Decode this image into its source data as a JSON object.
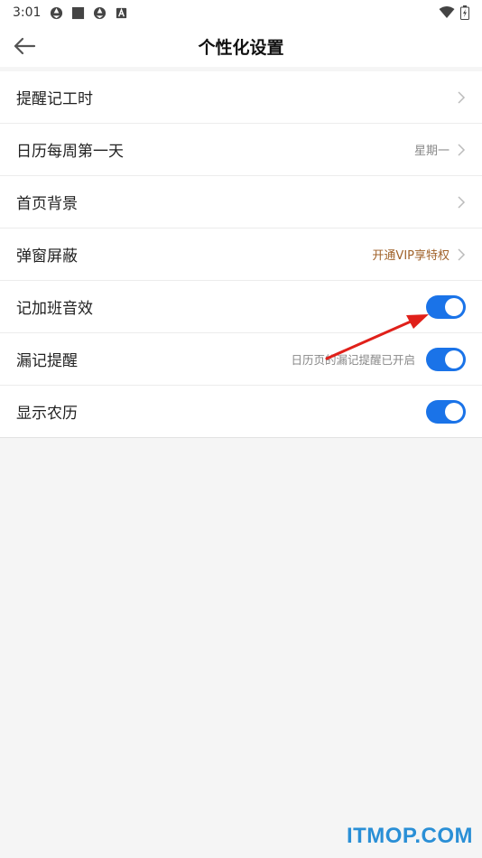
{
  "status_bar": {
    "time": "3:01",
    "icons": [
      "aperture-icon",
      "square-icon",
      "aperture-icon",
      "a-badge-icon"
    ],
    "right_icons": [
      "wifi-icon",
      "battery-charging-icon"
    ]
  },
  "header": {
    "title": "个性化设置",
    "back_icon": "arrow-left-icon"
  },
  "settings": [
    {
      "label": "提醒记工时",
      "type": "link"
    },
    {
      "label": "日历每周第一天",
      "type": "link",
      "value": "星期一"
    },
    {
      "label": "首页背景",
      "type": "link"
    },
    {
      "label": "弹窗屏蔽",
      "type": "link",
      "value": "开通VIP享特权"
    },
    {
      "label": "记加班音效",
      "type": "toggle",
      "on": true
    },
    {
      "label": "漏记提醒",
      "type": "toggle",
      "on": true,
      "hint": "日历页的漏记提醒已开启"
    },
    {
      "label": "显示农历",
      "type": "toggle",
      "on": true
    }
  ],
  "colors": {
    "accent": "#1a73e8",
    "vip_text": "#a0622a",
    "annotation_arrow": "#e0201a",
    "watermark": "#2a8fd6"
  },
  "watermark": "ITMOP.COM"
}
